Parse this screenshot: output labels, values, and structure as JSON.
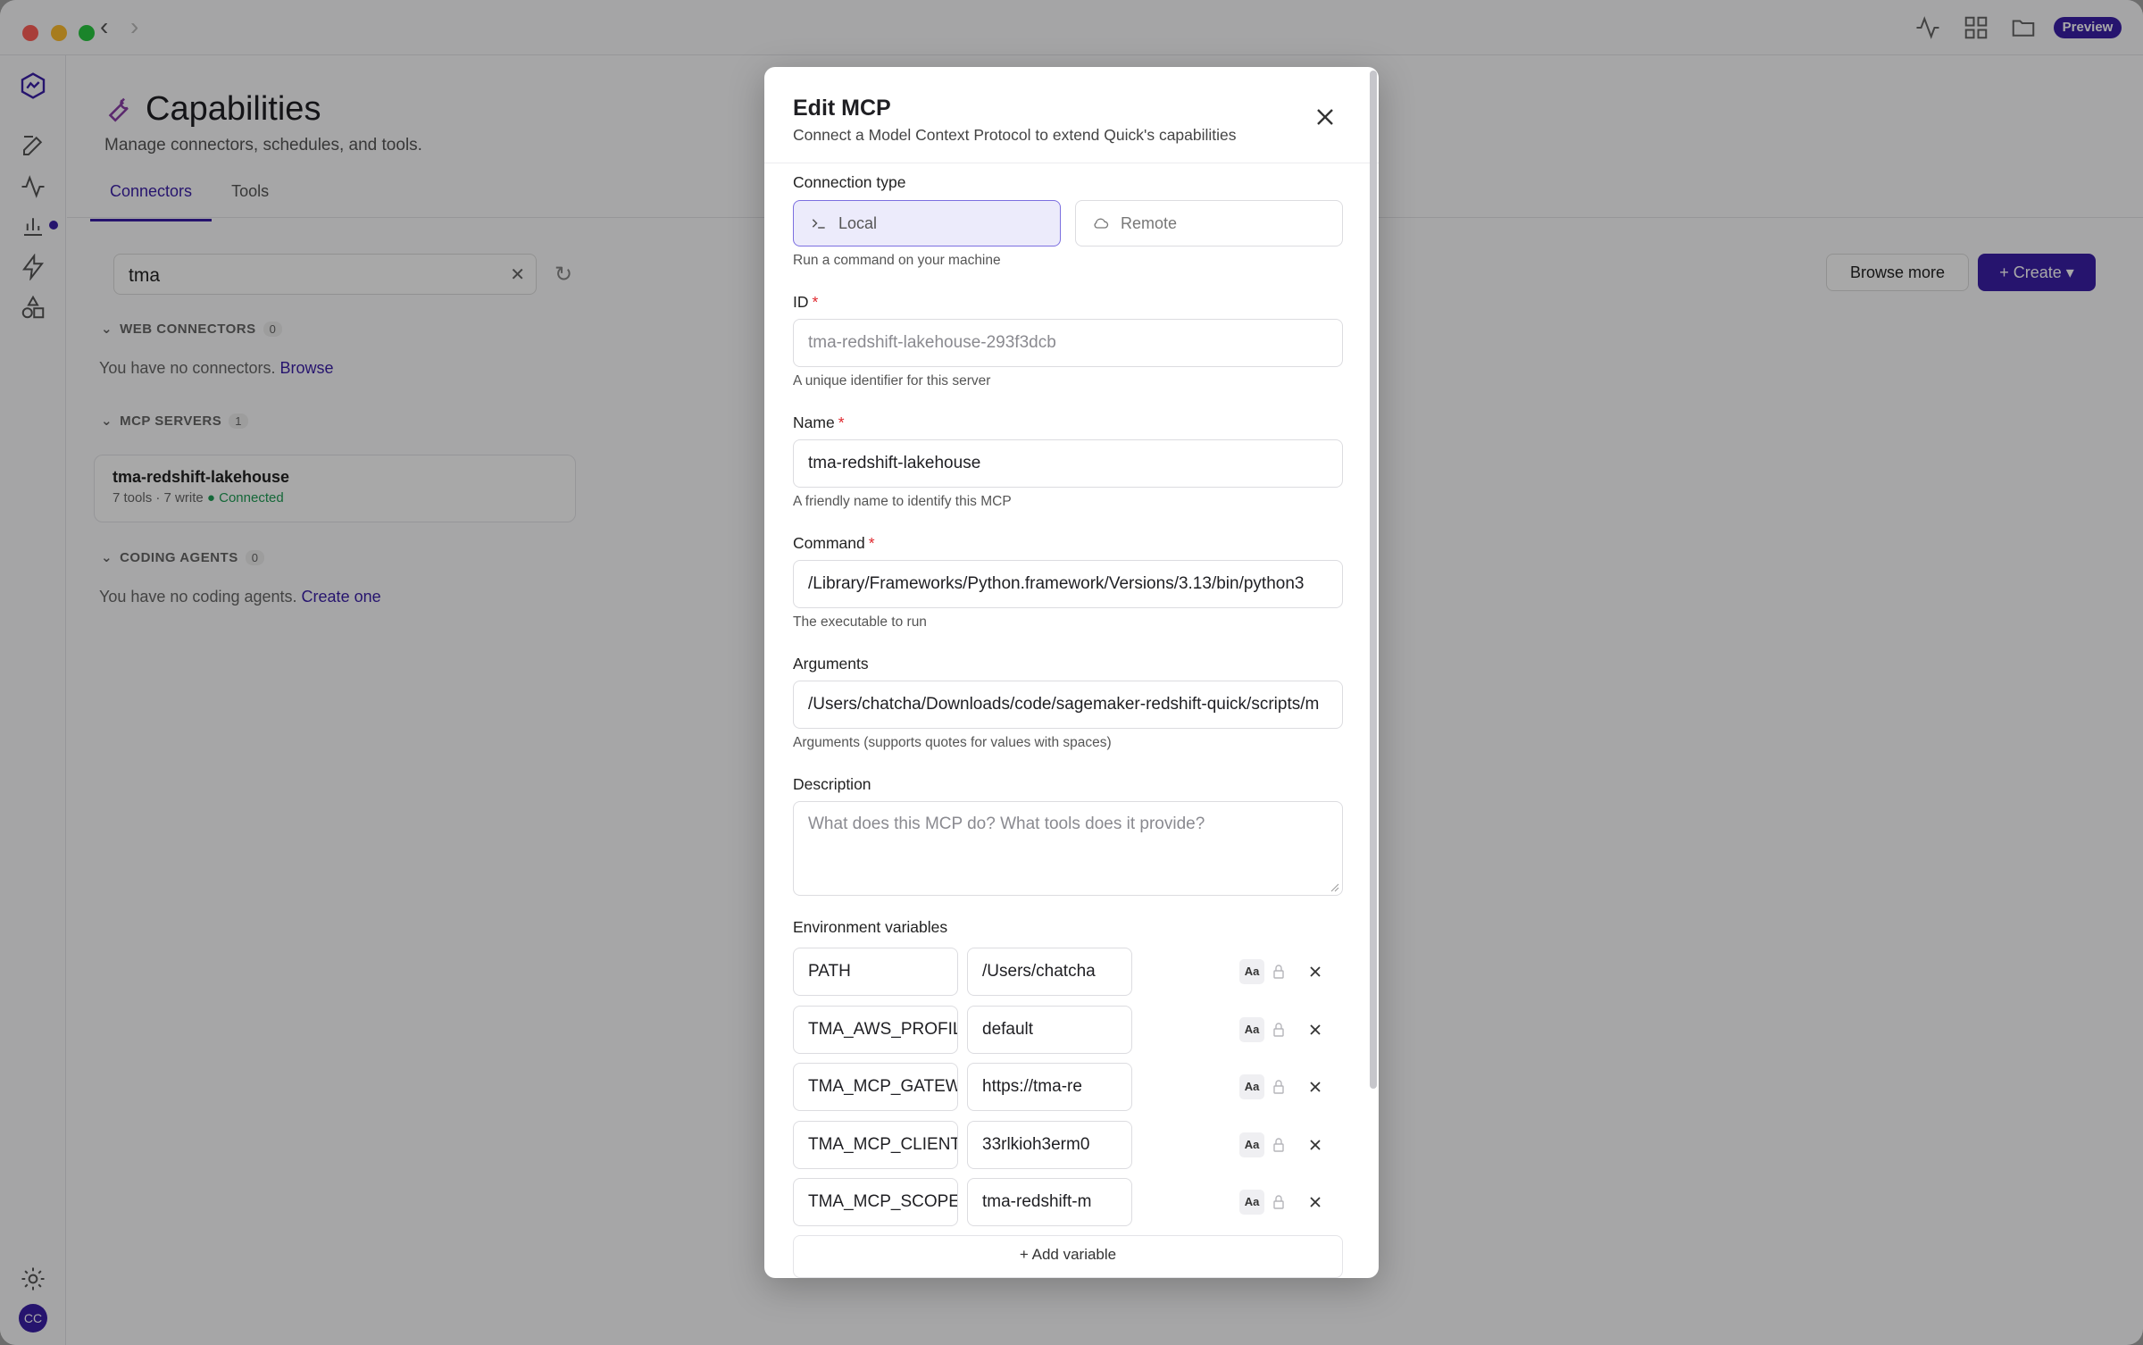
{
  "app": {
    "preview_badge": "Preview",
    "avatar_initials": "CC",
    "accent_color": "#3b1fa8"
  },
  "page": {
    "title": "Capabilities",
    "subtitle": "Manage connectors, schedules, and tools.",
    "tabs": [
      {
        "label": "Connectors",
        "active": true
      },
      {
        "label": "Tools",
        "active": false
      }
    ],
    "search_value": "tma",
    "browse_more_label": "Browse more",
    "create_label": "+ Create",
    "web_connectors": {
      "header": "WEB CONNECTORS",
      "count": "0",
      "empty_text": "You have no connectors.",
      "empty_link": "Browse"
    },
    "mcp_servers": {
      "header": "MCP SERVERS",
      "count": "1",
      "items": [
        {
          "name": "tma-redshift-lakehouse",
          "meta": "7 tools · 7 write",
          "status": "Connected"
        }
      ]
    },
    "coding_agents": {
      "header": "CODING AGENTS",
      "count": "0",
      "empty_text": "You have no coding agents.",
      "empty_link": "Create one"
    }
  },
  "modal": {
    "title": "Edit MCP",
    "subtitle": "Connect a Model Context Protocol to extend Quick's capabilities",
    "connection_type": {
      "label": "Connection type",
      "options": [
        {
          "label": "Local",
          "icon": "terminal-icon",
          "selected": true
        },
        {
          "label": "Remote",
          "icon": "cloud-icon",
          "selected": false
        }
      ],
      "helper": "Run a command on your machine"
    },
    "id_field": {
      "label": "ID",
      "value": "tma-redshift-lakehouse-293f3dcb",
      "helper": "A unique identifier for this server"
    },
    "name_field": {
      "label": "Name",
      "value": "tma-redshift-lakehouse",
      "helper": "A friendly name to identify this MCP"
    },
    "command_field": {
      "label": "Command",
      "value": "/Library/Frameworks/Python.framework/Versions/3.13/bin/python3",
      "helper": "The executable to run"
    },
    "arguments_field": {
      "label": "Arguments",
      "value": "/Users/chatcha/Downloads/code/sagemaker-redshift-quick/scripts/m",
      "helper": "Arguments (supports quotes for values with spaces)"
    },
    "description_field": {
      "label": "Description",
      "placeholder": "What does this MCP do? What tools does it provide?"
    },
    "env": {
      "label": "Environment variables",
      "aa_label": "Aa",
      "rows": [
        {
          "key": "PATH",
          "value": "/Users/chatcha"
        },
        {
          "key": "TMA_AWS_PROFIL",
          "value": "default"
        },
        {
          "key": "TMA_MCP_GATEW",
          "value": "https://tma-re"
        },
        {
          "key": "TMA_MCP_CLIENT",
          "value": "33rlkioh3erm0"
        },
        {
          "key": "TMA_MCP_SCOPE",
          "value": "tma-redshift-m"
        }
      ],
      "add_label": "+ Add variable"
    }
  }
}
